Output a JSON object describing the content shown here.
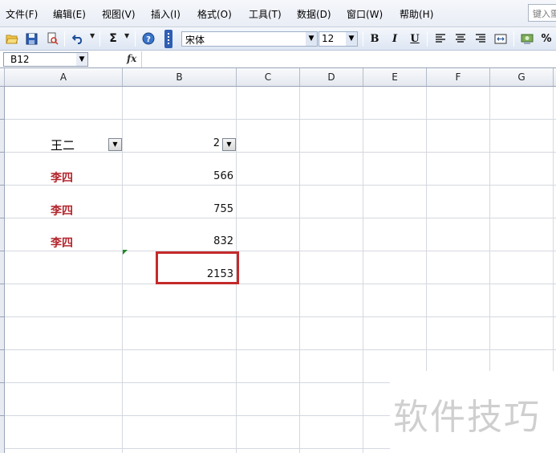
{
  "menu": {
    "items": [
      "文件(F)",
      "编辑(E)",
      "视图(V)",
      "插入(I)",
      "格式(O)",
      "工具(T)",
      "数据(D)",
      "窗口(W)",
      "帮助(H)"
    ],
    "help_placeholder": "键入需"
  },
  "toolbar": {
    "icons": [
      "open-folder-icon",
      "save-icon",
      "print-preview-icon",
      "undo-icon",
      "autosum-icon",
      "help-icon"
    ],
    "autosum_glyph": "Σ",
    "font_name": "宋体",
    "font_size": "12",
    "bold": "B",
    "italic": "I",
    "underline": "U",
    "percent": "%"
  },
  "formula_bar": {
    "cell_ref": "B12",
    "fx_label": "fx",
    "formula": ""
  },
  "sheet": {
    "columns": [
      "A",
      "B",
      "C",
      "D",
      "E",
      "F",
      "G"
    ],
    "rows": [
      {
        "name": "王二",
        "value": "2",
        "style": "plain",
        "has_filter": true
      },
      {
        "name": "李四",
        "value": "566",
        "style": "red",
        "has_filter": false
      },
      {
        "name": "李四",
        "value": "755",
        "style": "red",
        "has_filter": false
      },
      {
        "name": "李四",
        "value": "832",
        "style": "red",
        "has_filter": false
      }
    ],
    "total": "2153"
  },
  "watermark": "软件技巧",
  "colors": {
    "red_text": "#b3262d",
    "highlight_border": "#c42a2a",
    "toolbar_grip": "#2f5fb4"
  }
}
